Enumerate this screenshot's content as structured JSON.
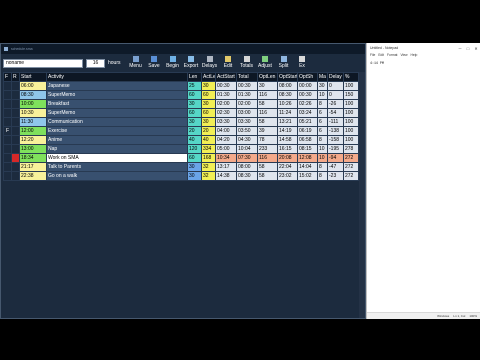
{
  "app": {
    "title": "schedule.sma"
  },
  "toolbar": {
    "name_value": "noname",
    "hours_value": "16",
    "hours_label": "hours",
    "buttons": [
      {
        "label": "Menu",
        "icon": "menu-icon",
        "color": "#7aa0d0"
      },
      {
        "label": "Save",
        "icon": "save-icon",
        "color": "#5a8fd6"
      },
      {
        "label": "Begin",
        "icon": "begin-icon",
        "color": "#6fb1e6"
      },
      {
        "label": "Export",
        "icon": "export-icon",
        "color": "#88bde9"
      },
      {
        "label": "Delays",
        "icon": "delays-icon",
        "color": "#b0b8c4"
      },
      {
        "label": "Edit",
        "icon": "edit-icon",
        "color": "#e2c96a"
      },
      {
        "label": "Totals",
        "icon": "totals-icon",
        "color": "#d6d6d6"
      },
      {
        "label": "Adjust",
        "icon": "adjust-icon",
        "color": "#7fcf7f"
      },
      {
        "label": "Split",
        "icon": "split-icon",
        "color": "#8fb6e0"
      },
      {
        "label": "Ex",
        "icon": "exit-icon",
        "color": "#d9d9d9"
      }
    ]
  },
  "grid": {
    "headers": [
      "F",
      "R",
      "Start",
      "Activity",
      "Len",
      "ActLen",
      "ActStart",
      "Total",
      "OptLen",
      "OptStart",
      "OptSh",
      "Ma",
      "Delay",
      "%"
    ],
    "rows": [
      {
        "f": "",
        "r": "",
        "start": "06:00",
        "start_color": "yellow",
        "activity": "Japanese",
        "len": "25",
        "len_color": "teal",
        "actlen": "30",
        "actstart": "00:30",
        "total": "00:30",
        "optlen": "30",
        "optstart": "08:00",
        "optsh": "00:00",
        "ma": "30",
        "delay": "0",
        "pct": "100",
        "current": false
      },
      {
        "f": "",
        "r": "",
        "start": "08:30",
        "start_color": "blue",
        "activity": "SuperMemo",
        "len": "60",
        "len_color": "teal",
        "actlen": "60",
        "actstart": "01:30",
        "total": "01:30",
        "optlen": "116",
        "optstart": "08:30",
        "optsh": "00:30",
        "ma": "10",
        "delay": "0",
        "pct": "150",
        "current": false
      },
      {
        "f": "",
        "r": "",
        "start": "10:00",
        "start_color": "green",
        "activity": "Breakfast",
        "len": "30",
        "len_color": "teal",
        "actlen": "30",
        "actstart": "02:00",
        "total": "02:00",
        "optlen": "58",
        "optstart": "10:26",
        "optsh": "02:26",
        "ma": "8",
        "delay": "-26",
        "pct": "100",
        "current": false
      },
      {
        "f": "",
        "r": "",
        "start": "10:30",
        "start_color": "yellow",
        "activity": "SuperMemo",
        "len": "60",
        "len_color": "teal",
        "actlen": "60",
        "actstart": "02:30",
        "total": "03:00",
        "optlen": "116",
        "optstart": "11:24",
        "optsh": "03:24",
        "ma": "6",
        "delay": "-54",
        "pct": "100",
        "current": false
      },
      {
        "f": "",
        "r": "",
        "start": "11:30",
        "start_color": "blue",
        "activity": "Communication",
        "len": "30",
        "len_color": "teal",
        "actlen": "30",
        "actstart": "03:30",
        "total": "03:30",
        "optlen": "58",
        "optstart": "13:21",
        "optsh": "05:21",
        "ma": "6",
        "delay": "-111",
        "pct": "100",
        "current": false
      },
      {
        "f": "F",
        "r": "",
        "start": "12:00",
        "start_color": "green",
        "activity": "Exercise",
        "len": "20",
        "len_color": "teal",
        "actlen": "20",
        "actstart": "04:00",
        "total": "03:50",
        "optlen": "39",
        "optstart": "14:19",
        "optsh": "06:19",
        "ma": "6",
        "delay": "-138",
        "pct": "100",
        "current": false
      },
      {
        "f": "",
        "r": "",
        "start": "12:20",
        "start_color": "yellow",
        "activity": "Anime",
        "len": "40",
        "len_color": "teal",
        "actlen": "40",
        "actstart": "04:20",
        "total": "04:30",
        "optlen": "78",
        "optstart": "14:58",
        "optsh": "06:58",
        "ma": "8",
        "delay": "-158",
        "pct": "100",
        "current": false
      },
      {
        "f": "",
        "r": "",
        "start": "13:00",
        "start_color": "green",
        "activity": "Nap",
        "len": "120",
        "len_color": "teal",
        "actlen": "334",
        "actstart": "05:00",
        "total": "10:04",
        "optlen": "233",
        "optstart": "16:15",
        "optsh": "08:15",
        "ma": "10",
        "delay": "-195",
        "pct": "278",
        "current": false
      },
      {
        "f": "",
        "r": "",
        "start": "18:34",
        "start_color": "green",
        "activity": "Work on SMA",
        "len": "60",
        "len_color": "teal",
        "actlen": "168",
        "actstart": "10:34",
        "total": "07:30",
        "optlen": "116",
        "optstart": "20:08",
        "optsh": "12:08",
        "ma": "10",
        "delay": "-94",
        "pct": "272",
        "current": true
      },
      {
        "f": "",
        "r": "",
        "start": "21:17",
        "start_color": "yellow",
        "activity": "Talk to Parents",
        "len": "30",
        "len_color": "blue",
        "actlen": "32",
        "actstart": "13:17",
        "total": "08:00",
        "optlen": "58",
        "optstart": "22:04",
        "optsh": "14:04",
        "ma": "8",
        "delay": "-47",
        "pct": "272",
        "current": false
      },
      {
        "f": "",
        "r": "",
        "start": "22:38",
        "start_color": "yellow",
        "activity": "Go on a walk",
        "len": "30",
        "len_color": "blue",
        "actlen": "32",
        "actstart": "14:38",
        "total": "08:30",
        "optlen": "58",
        "optstart": "23:02",
        "optsh": "15:02",
        "ma": "8",
        "delay": "-23",
        "pct": "272",
        "current": false
      }
    ]
  },
  "notepad": {
    "title": "Untitled - Notepad",
    "menu": [
      "File",
      "Edit",
      "Format",
      "View",
      "Help"
    ],
    "text": "4:14 PM",
    "status": [
      "Windows",
      "Ln 1, Col",
      "100%"
    ],
    "controls": [
      "─",
      "□",
      "✕"
    ]
  }
}
